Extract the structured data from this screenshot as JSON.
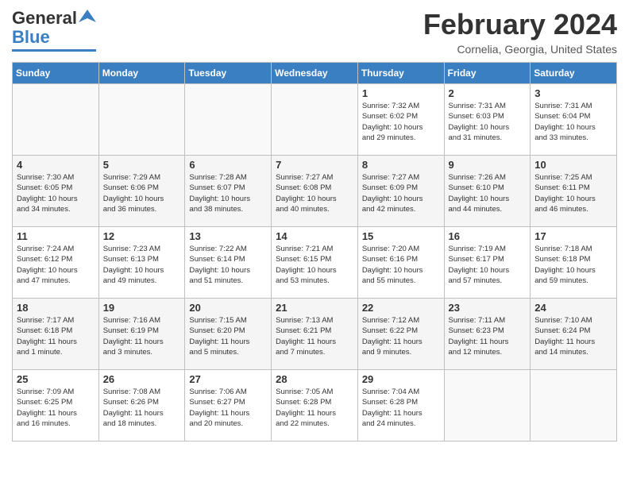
{
  "logo": {
    "line1": "General",
    "line2": "Blue"
  },
  "title": "February 2024",
  "location": "Cornelia, Georgia, United States",
  "days_of_week": [
    "Sunday",
    "Monday",
    "Tuesday",
    "Wednesday",
    "Thursday",
    "Friday",
    "Saturday"
  ],
  "weeks": [
    [
      {
        "day": "",
        "info": ""
      },
      {
        "day": "",
        "info": ""
      },
      {
        "day": "",
        "info": ""
      },
      {
        "day": "",
        "info": ""
      },
      {
        "day": "1",
        "info": "Sunrise: 7:32 AM\nSunset: 6:02 PM\nDaylight: 10 hours\nand 29 minutes."
      },
      {
        "day": "2",
        "info": "Sunrise: 7:31 AM\nSunset: 6:03 PM\nDaylight: 10 hours\nand 31 minutes."
      },
      {
        "day": "3",
        "info": "Sunrise: 7:31 AM\nSunset: 6:04 PM\nDaylight: 10 hours\nand 33 minutes."
      }
    ],
    [
      {
        "day": "4",
        "info": "Sunrise: 7:30 AM\nSunset: 6:05 PM\nDaylight: 10 hours\nand 34 minutes."
      },
      {
        "day": "5",
        "info": "Sunrise: 7:29 AM\nSunset: 6:06 PM\nDaylight: 10 hours\nand 36 minutes."
      },
      {
        "day": "6",
        "info": "Sunrise: 7:28 AM\nSunset: 6:07 PM\nDaylight: 10 hours\nand 38 minutes."
      },
      {
        "day": "7",
        "info": "Sunrise: 7:27 AM\nSunset: 6:08 PM\nDaylight: 10 hours\nand 40 minutes."
      },
      {
        "day": "8",
        "info": "Sunrise: 7:27 AM\nSunset: 6:09 PM\nDaylight: 10 hours\nand 42 minutes."
      },
      {
        "day": "9",
        "info": "Sunrise: 7:26 AM\nSunset: 6:10 PM\nDaylight: 10 hours\nand 44 minutes."
      },
      {
        "day": "10",
        "info": "Sunrise: 7:25 AM\nSunset: 6:11 PM\nDaylight: 10 hours\nand 46 minutes."
      }
    ],
    [
      {
        "day": "11",
        "info": "Sunrise: 7:24 AM\nSunset: 6:12 PM\nDaylight: 10 hours\nand 47 minutes."
      },
      {
        "day": "12",
        "info": "Sunrise: 7:23 AM\nSunset: 6:13 PM\nDaylight: 10 hours\nand 49 minutes."
      },
      {
        "day": "13",
        "info": "Sunrise: 7:22 AM\nSunset: 6:14 PM\nDaylight: 10 hours\nand 51 minutes."
      },
      {
        "day": "14",
        "info": "Sunrise: 7:21 AM\nSunset: 6:15 PM\nDaylight: 10 hours\nand 53 minutes."
      },
      {
        "day": "15",
        "info": "Sunrise: 7:20 AM\nSunset: 6:16 PM\nDaylight: 10 hours\nand 55 minutes."
      },
      {
        "day": "16",
        "info": "Sunrise: 7:19 AM\nSunset: 6:17 PM\nDaylight: 10 hours\nand 57 minutes."
      },
      {
        "day": "17",
        "info": "Sunrise: 7:18 AM\nSunset: 6:18 PM\nDaylight: 10 hours\nand 59 minutes."
      }
    ],
    [
      {
        "day": "18",
        "info": "Sunrise: 7:17 AM\nSunset: 6:18 PM\nDaylight: 11 hours\nand 1 minute."
      },
      {
        "day": "19",
        "info": "Sunrise: 7:16 AM\nSunset: 6:19 PM\nDaylight: 11 hours\nand 3 minutes."
      },
      {
        "day": "20",
        "info": "Sunrise: 7:15 AM\nSunset: 6:20 PM\nDaylight: 11 hours\nand 5 minutes."
      },
      {
        "day": "21",
        "info": "Sunrise: 7:13 AM\nSunset: 6:21 PM\nDaylight: 11 hours\nand 7 minutes."
      },
      {
        "day": "22",
        "info": "Sunrise: 7:12 AM\nSunset: 6:22 PM\nDaylight: 11 hours\nand 9 minutes."
      },
      {
        "day": "23",
        "info": "Sunrise: 7:11 AM\nSunset: 6:23 PM\nDaylight: 11 hours\nand 12 minutes."
      },
      {
        "day": "24",
        "info": "Sunrise: 7:10 AM\nSunset: 6:24 PM\nDaylight: 11 hours\nand 14 minutes."
      }
    ],
    [
      {
        "day": "25",
        "info": "Sunrise: 7:09 AM\nSunset: 6:25 PM\nDaylight: 11 hours\nand 16 minutes."
      },
      {
        "day": "26",
        "info": "Sunrise: 7:08 AM\nSunset: 6:26 PM\nDaylight: 11 hours\nand 18 minutes."
      },
      {
        "day": "27",
        "info": "Sunrise: 7:06 AM\nSunset: 6:27 PM\nDaylight: 11 hours\nand 20 minutes."
      },
      {
        "day": "28",
        "info": "Sunrise: 7:05 AM\nSunset: 6:28 PM\nDaylight: 11 hours\nand 22 minutes."
      },
      {
        "day": "29",
        "info": "Sunrise: 7:04 AM\nSunset: 6:28 PM\nDaylight: 11 hours\nand 24 minutes."
      },
      {
        "day": "",
        "info": ""
      },
      {
        "day": "",
        "info": ""
      }
    ]
  ]
}
